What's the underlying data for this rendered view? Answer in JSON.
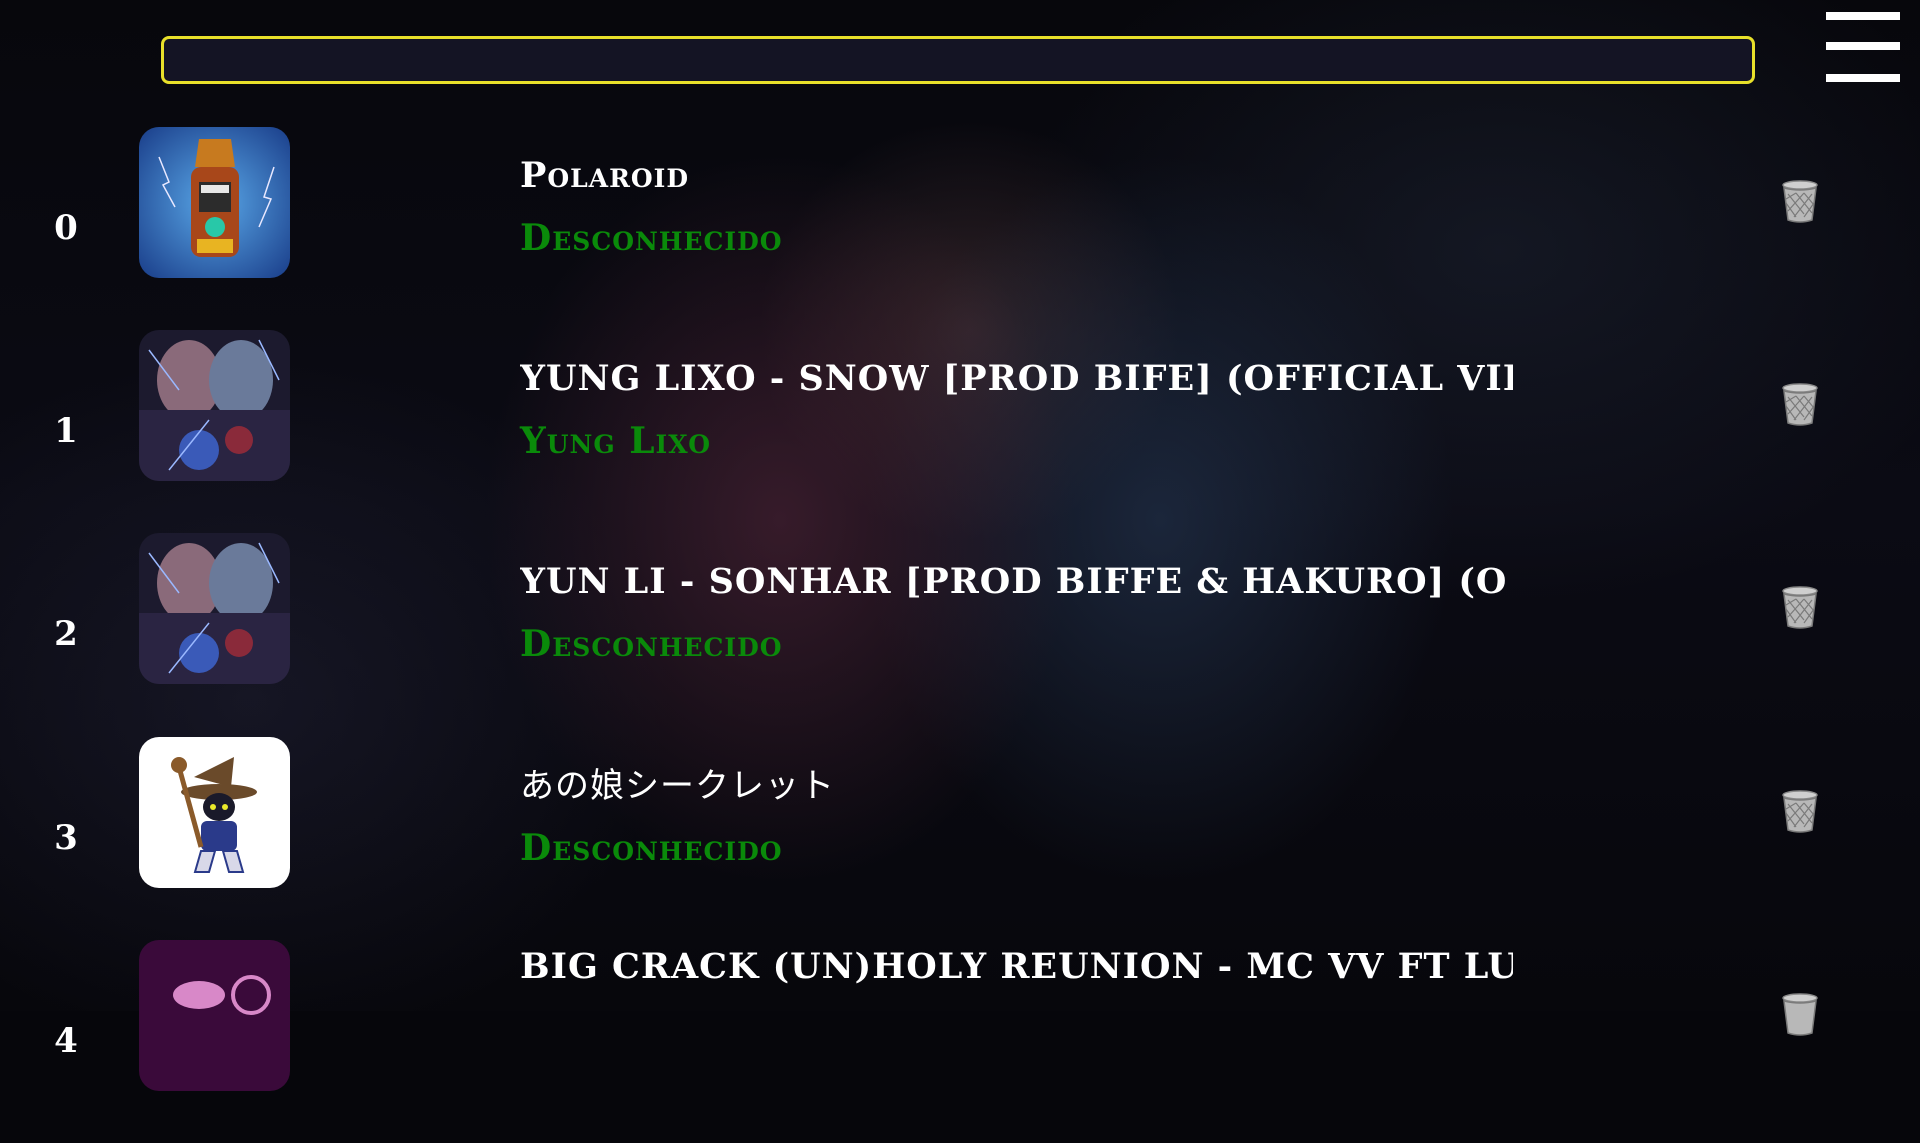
{
  "search": {
    "placeholder": "",
    "value": "",
    "border_color": "#e8e02a"
  },
  "menu": {
    "icon": "hamburger-menu-icon"
  },
  "playlist": [
    {
      "index": "0",
      "title": "Polaroid",
      "artist": "Desconhecido",
      "thumb": "golden-hand-artwork",
      "delete_icon": "trash-icon"
    },
    {
      "index": "1",
      "title": "YUNG LIXO - SNOW [PROD BIFE] (OFFICIAL VID",
      "artist": "Yung Lixo",
      "thumb": "dark-duel-artwork",
      "delete_icon": "trash-icon"
    },
    {
      "index": "2",
      "title": "YUN LI - SONHAR [PROD BIFFE & HAKURO] (O",
      "artist": "Desconhecido",
      "thumb": "dark-duel-artwork",
      "delete_icon": "trash-icon"
    },
    {
      "index": "3",
      "title": "あの娘シークレット",
      "artist": "Desconhecido",
      "thumb": "black-mage-artwork",
      "delete_icon": "trash-icon"
    },
    {
      "index": "4",
      "title": "BIG CRACK (UN)HOLY REUNION - MC VV FT LU",
      "artist": "",
      "thumb": "pink-artwork",
      "delete_icon": "trash-icon"
    }
  ],
  "colors": {
    "title": "#ffffff",
    "artist": "#0a8a0a",
    "index": "#ffffff"
  }
}
